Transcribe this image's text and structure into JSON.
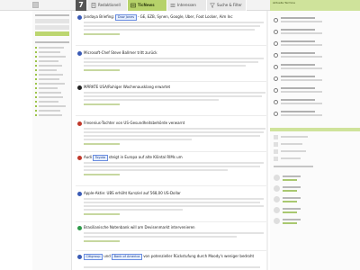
{
  "header": {
    "day_badge": "7",
    "tabs": [
      {
        "label": "Redaktionell",
        "active": false,
        "icon": "document-icon"
      },
      {
        "label": "TicNews",
        "active": true,
        "icon": "news-icon"
      },
      {
        "label": "Interessen",
        "active": false,
        "icon": "list-icon"
      },
      {
        "label": "Suche & Filter",
        "active": false,
        "icon": "filter-icon"
      }
    ],
    "right_panel_label": "Aktuelle Termine"
  },
  "feed": {
    "items": [
      {
        "icon": "flag-us-icon",
        "title_pre": "Jandaya Briefing: ",
        "chip": "Dow Jones",
        "title_post": " - GE, EZB, Synen, Google, Uber, Foot Locker, Aim Inc"
      },
      {
        "icon": "flag-us-icon",
        "title_pre": "Microsoft-Chef Steve Ballmer tritt zurück",
        "chip": "",
        "title_post": ""
      },
      {
        "icon": "flag-de-icon",
        "title_pre": "MÄRKTE USA/Ruhiger Wochenausklang erwartet",
        "chip": "",
        "title_post": ""
      },
      {
        "icon": "flag-de-icon",
        "title_pre": "Fresenius-Tochter von US-Gesundheitsbehörde verwarnt",
        "chip": "",
        "title_post": ""
      },
      {
        "icon": "flag-de-icon",
        "title_pre": "Audi ",
        "chip": "Toyota",
        "title_post": " steigt in Europa auf alte Klöntal RIMs um"
      },
      {
        "icon": "flag-us-icon",
        "title_pre": "Apple-Aktie: UBS erhöht Kursziel auf 568,00 US-Dollar",
        "chip": "",
        "title_post": ""
      },
      {
        "icon": "flag-br-icon",
        "title_pre": "Brasilianische Notenbank will am Devisenmarkt intervenieren",
        "chip": "",
        "title_post": ""
      },
      {
        "icon": "flag-us-icon",
        "title_pre": "",
        "chip": "Citigroup",
        "title_mid": " und ",
        "chip2": "Bank of America",
        "title_post": " von potenzieller Rückstufung durch Moody's weniger bedroht"
      }
    ]
  },
  "colors": {
    "accent_green": "#b6d26a",
    "light_green": "#cfe39b",
    "chip_blue": "#6a8de0"
  }
}
